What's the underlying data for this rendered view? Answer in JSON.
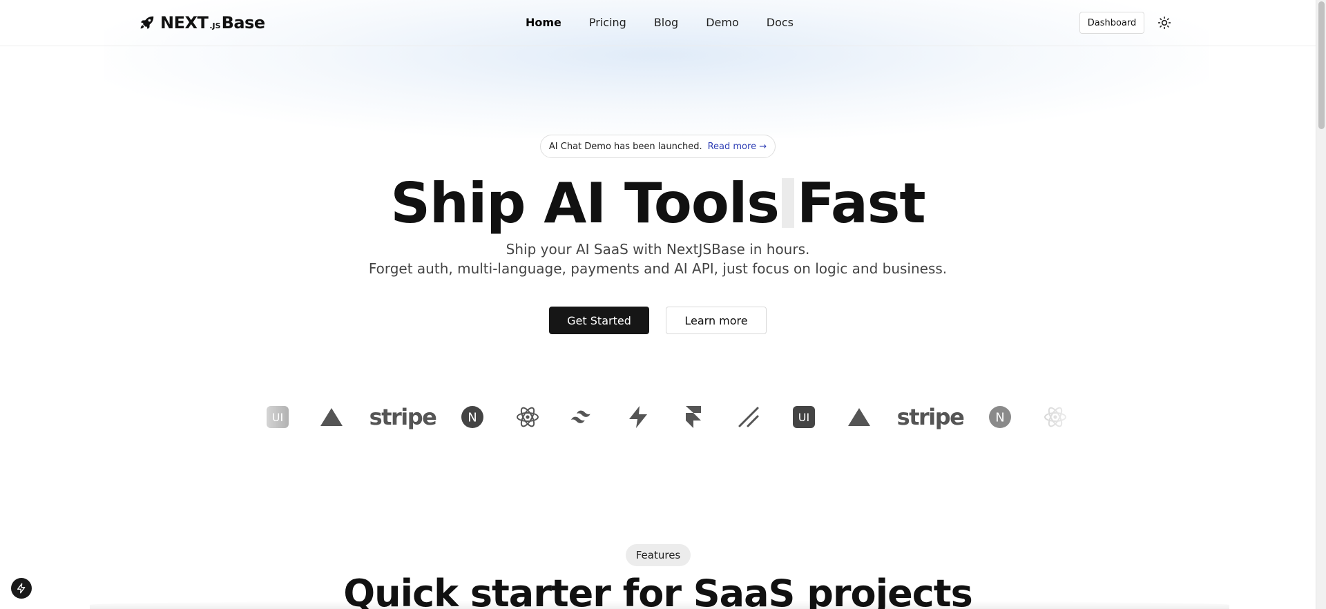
{
  "brand": {
    "name_part1": "NEXT",
    "name_part2": ".JS",
    "name_part3": "Base",
    "icon": "rocket-icon"
  },
  "nav": {
    "items": [
      "Home",
      "Pricing",
      "Blog",
      "Demo",
      "Docs"
    ],
    "active": "Home"
  },
  "header": {
    "dashboard_label": "Dashboard",
    "theme_icon": "sun-icon"
  },
  "announcement": {
    "text": "AI Chat Demo has been launched.",
    "link_label": "Read more →"
  },
  "hero": {
    "title_part1": "Ship AI Tools",
    "title_part2": "Fast",
    "subtitle_line1": "Ship your AI SaaS with NextJSBase in hours.",
    "subtitle_line2": "Forget auth, multi-language, payments and AI API, just focus on logic and business.",
    "primary_cta": "Get Started",
    "secondary_cta": "Learn more"
  },
  "logos": {
    "items": [
      {
        "name": "shadcn-ui-logo",
        "label": "UI"
      },
      {
        "name": "vercel-logo"
      },
      {
        "name": "stripe-logo",
        "label": "stripe"
      },
      {
        "name": "nextjs-logo",
        "label": "N"
      },
      {
        "name": "react-logo"
      },
      {
        "name": "tailwind-logo"
      },
      {
        "name": "supabase-logo"
      },
      {
        "name": "framer-logo"
      },
      {
        "name": "shadcn-logo"
      },
      {
        "name": "shadcn-ui-logo",
        "label": "UI"
      },
      {
        "name": "vercel-logo"
      },
      {
        "name": "stripe-logo",
        "label": "stripe"
      },
      {
        "name": "nextjs-logo",
        "label": "N"
      },
      {
        "name": "react-logo"
      }
    ]
  },
  "features": {
    "pill_label": "Features",
    "title": "Quick starter for SaaS projects"
  },
  "colors": {
    "primary": "#161616",
    "link": "#2f3fb5",
    "muted_text": "#444444",
    "logo_gray": "#555555"
  },
  "floating_button": {
    "icon": "lightning-icon"
  }
}
